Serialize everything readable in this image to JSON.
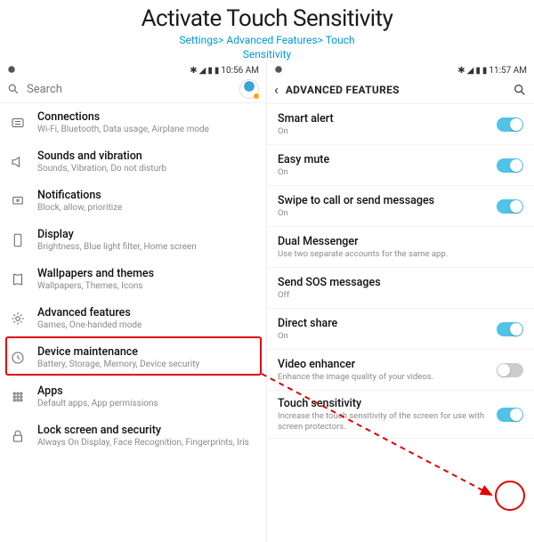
{
  "header": {
    "title": "Activate Touch Sensitivity",
    "breadcrumb_line1": "Settings> Advanced Features> Touch",
    "breadcrumb_line2": "Sensitivity"
  },
  "left": {
    "status_time": "10:56 AM",
    "search_placeholder": "Search",
    "items": [
      {
        "icon": "connections",
        "name": "Connections",
        "sub": "Wi-Fi, Bluetooth, Data usage, Airplane mode"
      },
      {
        "icon": "sound",
        "name": "Sounds and vibration",
        "sub": "Sounds, Vibration, Do not disturb"
      },
      {
        "icon": "notifications",
        "name": "Notifications",
        "sub": "Block, allow, prioritize"
      },
      {
        "icon": "display",
        "name": "Display",
        "sub": "Brightness, Blue light filter, Home screen"
      },
      {
        "icon": "wallpaper",
        "name": "Wallpapers and themes",
        "sub": "Wallpapers, Themes, Icons"
      },
      {
        "icon": "advanced",
        "name": "Advanced features",
        "sub": "Games, One-handed mode"
      },
      {
        "icon": "maintenance",
        "name": "Device maintenance",
        "sub": "Battery, Storage, Memory, Device security"
      },
      {
        "icon": "apps",
        "name": "Apps",
        "sub": "Default apps, App permissions"
      },
      {
        "icon": "lock",
        "name": "Lock screen and security",
        "sub": "Always On Display, Face Recognition, Fingerprints, Iris"
      }
    ]
  },
  "right": {
    "status_time": "11:57 AM",
    "title": "ADVANCED FEATURES",
    "items": [
      {
        "name": "Smart alert",
        "sub": "On",
        "toggle": "on"
      },
      {
        "name": "Easy mute",
        "sub": "On",
        "toggle": "on"
      },
      {
        "name": "Swipe to call or send messages",
        "sub": "On",
        "toggle": "on"
      },
      {
        "name": "Dual Messenger",
        "sub": "Use two separate accounts for the same app.",
        "toggle": null
      },
      {
        "name": "Send SOS messages",
        "sub": "Off",
        "toggle": null
      },
      {
        "name": "Direct share",
        "sub": "On",
        "toggle": "on"
      },
      {
        "name": "Video enhancer",
        "sub": "Enhance the image quality of your videos.",
        "toggle": "off"
      },
      {
        "name": "Touch sensitivity",
        "sub": "Increase the touch sensitivity of the screen for use with screen protectors.",
        "toggle": "on"
      }
    ]
  }
}
